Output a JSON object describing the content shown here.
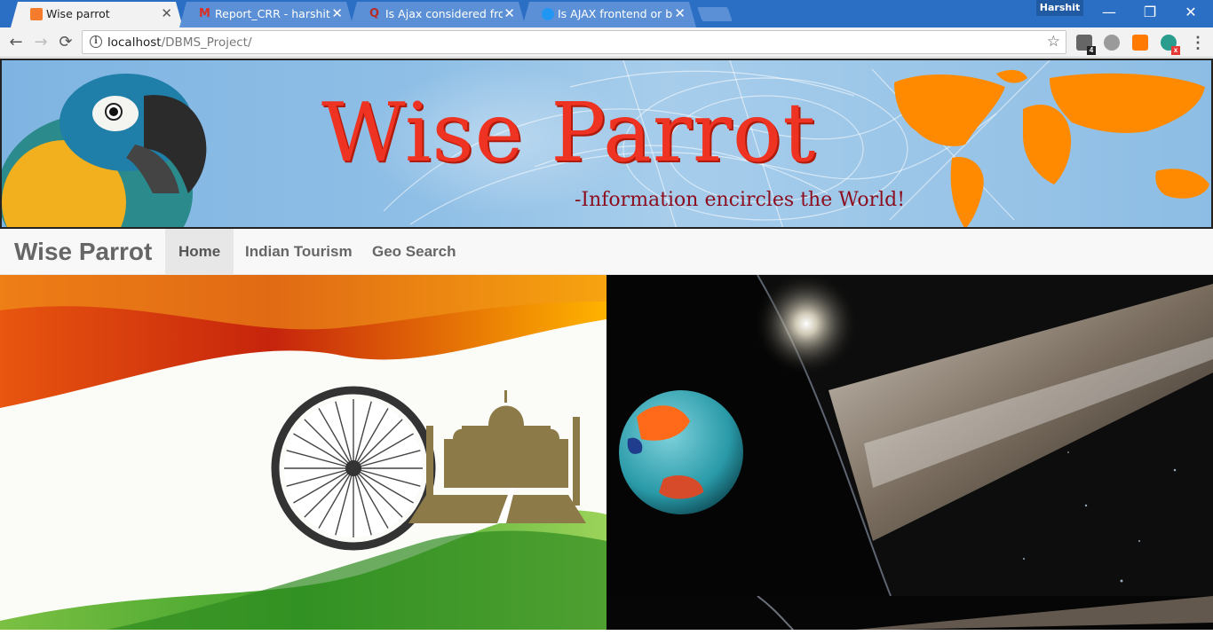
{
  "browser": {
    "tabs": [
      {
        "title": "Wise parrot",
        "active": true,
        "favicon": "xampp-icon",
        "favicon_color": "#f47c2c"
      },
      {
        "title": "Report_CRR - harshitguj",
        "active": false,
        "favicon": "gmail-icon",
        "favicon_color": "#d93025"
      },
      {
        "title": "Is Ajax considered front-",
        "active": false,
        "favicon": "quora-icon",
        "favicon_color": "#b92b27"
      },
      {
        "title": "Is AJAX frontend or back",
        "active": false,
        "favicon": "chat-bubble-icon",
        "favicon_color": "#2196f3"
      }
    ],
    "close_glyph": "✕",
    "profile_name": "Harshit",
    "window_controls": {
      "minimize": "—",
      "restore": "❐",
      "close": "✕"
    },
    "nav": {
      "back": "←",
      "forward": "→",
      "reload": "⟳"
    },
    "url_host": "localhost",
    "url_path": "/DBMS_Project/",
    "info_glyph": "i",
    "bookmark_glyph": "☆",
    "extensions": [
      {
        "name": "extension-1-icon",
        "badge": "4",
        "color": "#555555",
        "badge_color": "#222222"
      },
      {
        "name": "extension-2-icon",
        "badge": "",
        "color": "#8a8a8a",
        "badge_color": ""
      },
      {
        "name": "extension-tm-icon",
        "badge": "",
        "color": "#ff7a00",
        "badge_color": ""
      },
      {
        "name": "extension-chat-icon",
        "badge": "x",
        "color": "#2a9d8f",
        "badge_color": "#e53935"
      }
    ],
    "menu_glyph": "⋮",
    "accent": "#2a6fc4"
  },
  "page": {
    "banner": {
      "title": "Wise Parrot",
      "tagline": "-Information encircles the World!",
      "title_color": "#ee3322",
      "tagline_color": "#8b0d1e"
    },
    "navbar": {
      "brand": "Wise Parrot",
      "items": [
        {
          "label": "Home",
          "active": true
        },
        {
          "label": "Indian Tourism",
          "active": false
        },
        {
          "label": "Geo Search",
          "active": false
        }
      ]
    },
    "panels": [
      {
        "name": "indian-tourism-image",
        "description_icons": [
          "ashoka-chakra-icon",
          "taj-mahal-icon"
        ]
      },
      {
        "name": "geo-search-image",
        "description_icons": [
          "globe-icon",
          "planet-rings-icon"
        ]
      }
    ]
  }
}
